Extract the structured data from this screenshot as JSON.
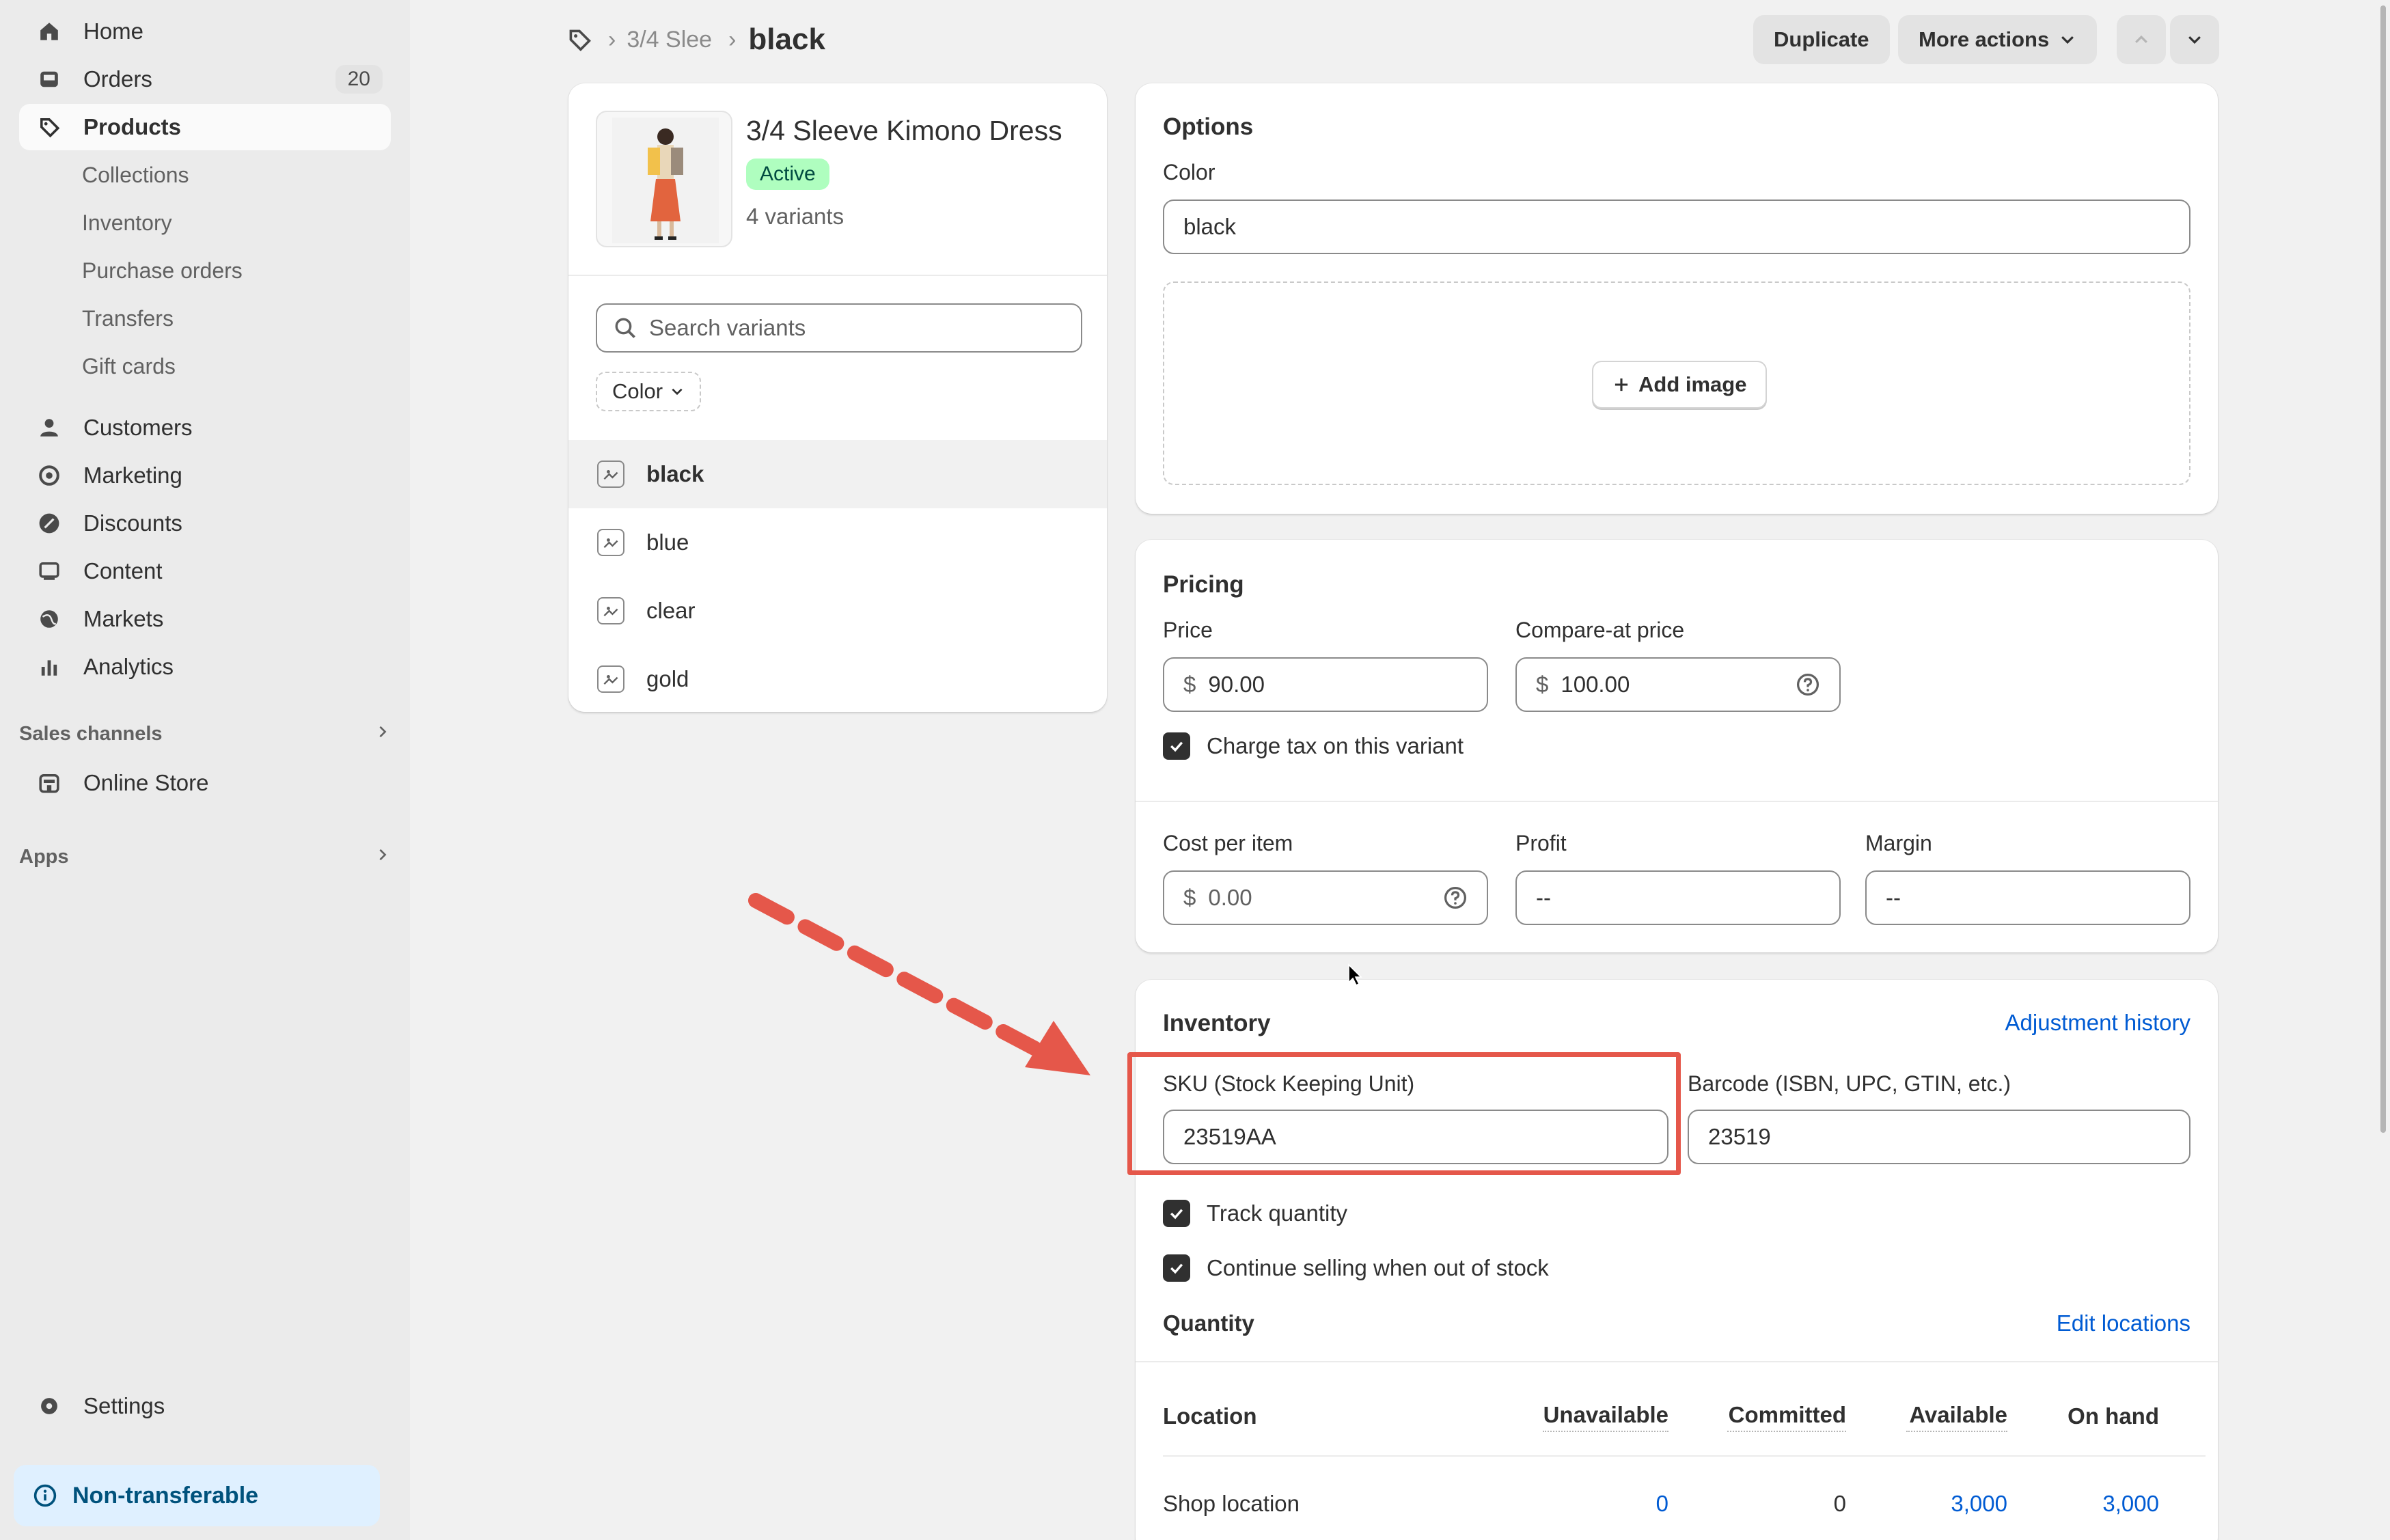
{
  "sidebar": {
    "home": "Home",
    "orders": "Orders",
    "orders_count": "20",
    "products": "Products",
    "sub_items": [
      "Collections",
      "Inventory",
      "Purchase orders",
      "Transfers",
      "Gift cards"
    ],
    "customers": "Customers",
    "marketing": "Marketing",
    "discounts": "Discounts",
    "content": "Content",
    "markets": "Markets",
    "analytics": "Analytics",
    "sales_channels": "Sales channels",
    "online_store": "Online Store",
    "apps": "Apps",
    "settings": "Settings",
    "non_transferable": "Non-transferable"
  },
  "header": {
    "breadcrumb_parent": "3/4 Slee",
    "title": "black",
    "duplicate": "Duplicate",
    "more_actions": "More actions"
  },
  "product": {
    "name": "3/4 Sleeve Kimono Dress",
    "status": "Active",
    "variant_count": "4 variants",
    "search_placeholder": "Search variants",
    "filter_label": "Color",
    "variants": [
      "black",
      "blue",
      "clear",
      "gold"
    ]
  },
  "options": {
    "title": "Options",
    "color_label": "Color",
    "color_value": "black",
    "add_image": "Add image"
  },
  "pricing": {
    "title": "Pricing",
    "price_label": "Price",
    "currency": "$",
    "price": "90.00",
    "compare_label": "Compare-at price",
    "compare_price": "100.00",
    "charge_tax": "Charge tax on this variant",
    "cost_label": "Cost per item",
    "cost": "0.00",
    "profit_label": "Profit",
    "profit": "--",
    "margin_label": "Margin",
    "margin": "--"
  },
  "inventory": {
    "title": "Inventory",
    "adjustment_history": "Adjustment history",
    "sku_label": "SKU (Stock Keeping Unit)",
    "sku": "23519AA",
    "barcode_label": "Barcode (ISBN, UPC, GTIN, etc.)",
    "barcode": "23519",
    "track_quantity": "Track quantity",
    "continue_selling": "Continue selling when out of stock",
    "quantity_title": "Quantity",
    "edit_locations": "Edit locations",
    "columns": [
      "Location",
      "Unavailable",
      "Committed",
      "Available",
      "On hand"
    ],
    "rows": [
      {
        "location": "Shop location",
        "unavailable": "0",
        "committed": "0",
        "available": "3,000",
        "on_hand": "3,000"
      }
    ]
  },
  "colors": {
    "highlight": "#e5574a",
    "link": "#005bd3",
    "active_badge": "#affebf"
  }
}
